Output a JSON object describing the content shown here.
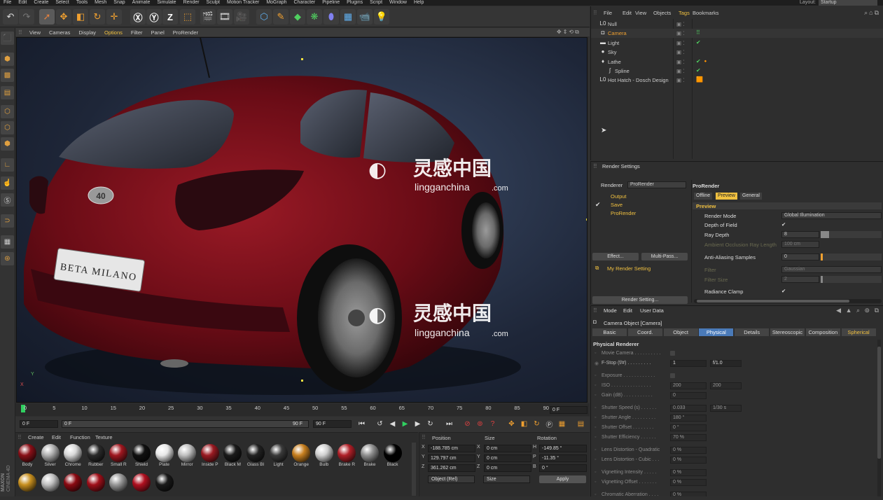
{
  "menubar": {
    "items": [
      "File",
      "Edit",
      "Create",
      "Select",
      "Tools",
      "Mesh",
      "Snap",
      "Animate",
      "Simulate",
      "Render",
      "Sculpt",
      "Motion Tracker",
      "MoGraph",
      "Character",
      "Pipeline",
      "Plugins",
      "Script",
      "Window",
      "Help"
    ],
    "layout_label": "Layout:",
    "layout_value": "Startup"
  },
  "viewport_menu": {
    "items": [
      "View",
      "Cameras",
      "Display",
      "Options",
      "Filter",
      "Panel",
      "ProRender"
    ],
    "active": "Options"
  },
  "viewport": {
    "plate_text": "BETA MILANO",
    "badge_text": "40",
    "watermark_cn": "灵感中国",
    "watermark_en": "lingganchina",
    "watermark_suffix": ".com",
    "axis_y": "Y",
    "axis_x": "X"
  },
  "timeline": {
    "ticks": [
      "0",
      "5",
      "10",
      "15",
      "20",
      "25",
      "30",
      "35",
      "40",
      "45",
      "50",
      "55",
      "60",
      "65",
      "70",
      "75",
      "80",
      "85",
      "90"
    ],
    "current_frame": "0 F"
  },
  "transport": {
    "start": "0 F",
    "preview_start": "0 F",
    "preview_end": "90 F",
    "end": "90 F"
  },
  "materials": {
    "menu": [
      "Create",
      "Edit",
      "Function",
      "Texture"
    ],
    "row1": [
      {
        "label": "Body",
        "color": "#8a1018"
      },
      {
        "label": "Silver",
        "color": "#b0b0b0"
      },
      {
        "label": "Chrome",
        "color": "#d8d8d8"
      },
      {
        "label": "Rubber",
        "color": "#2a2a2a"
      },
      {
        "label": "Small R",
        "color": "#a01820"
      },
      {
        "label": "Shield",
        "color": "#101010"
      },
      {
        "label": "Plate",
        "color": "#e8e8e8"
      },
      {
        "label": "Mirror",
        "color": "#c0c0c0"
      },
      {
        "label": "Inside P",
        "color": "#9a1a22"
      },
      {
        "label": "Black M",
        "color": "#1a1a1a"
      },
      {
        "label": "Glass Bl",
        "color": "#222222"
      },
      {
        "label": "Light",
        "color": "#3a3a3a"
      },
      {
        "label": "Orange",
        "color": "#c88020"
      },
      {
        "label": "Bulb",
        "color": "#d0d0d0"
      },
      {
        "label": "Brake R",
        "color": "#b02028"
      },
      {
        "label": "Brake",
        "color": "#909090"
      },
      {
        "label": "Black",
        "color": "#000000"
      }
    ],
    "row2": [
      {
        "color": "#c89020"
      },
      {
        "color": "#c0c0c0"
      },
      {
        "color": "#8a0a12"
      },
      {
        "color": "#a0101a"
      },
      {
        "color": "#999999"
      },
      {
        "color": "#b01020"
      },
      {
        "color": "#1a1a1a"
      }
    ]
  },
  "coords": {
    "headers": [
      "Position",
      "Size",
      "Rotation"
    ],
    "rows": [
      {
        "axis": "X",
        "pos": "-188.785 cm",
        "size_axis": "X",
        "size": "0 cm",
        "rot_axis": "H",
        "rot": "-149.85 °"
      },
      {
        "axis": "Y",
        "pos": "129.797 cm",
        "size_axis": "Y",
        "size": "0 cm",
        "rot_axis": "P",
        "rot": "-11.35 °"
      },
      {
        "axis": "Z",
        "pos": "361.262 cm",
        "size_axis": "Z",
        "size": "0 cm",
        "rot_axis": "B",
        "rot": "0 °"
      }
    ],
    "mode": "Object (Rel)",
    "size_mode": "Size",
    "apply": "Apply"
  },
  "object_manager": {
    "menu": [
      "File",
      "Edit",
      "View",
      "Objects",
      "Tags",
      "Bookmarks"
    ],
    "active_menu": "Tags",
    "objects": [
      {
        "name": "Null",
        "icon": "L0",
        "selected": false
      },
      {
        "name": "Camera",
        "icon": "◘",
        "selected": true
      },
      {
        "name": "Light",
        "icon": "▬",
        "selected": false
      },
      {
        "name": "Sky",
        "icon": "●",
        "selected": false
      },
      {
        "name": "Lathe",
        "icon": "♦",
        "selected": false
      },
      {
        "name": "Spline",
        "icon": "∫",
        "selected": false
      },
      {
        "name": "Hot Hatch - Dosch Design",
        "icon": "L0",
        "selected": false
      }
    ]
  },
  "render_settings": {
    "title": "Render Settings",
    "renderer_label": "Renderer",
    "renderer_value": "ProRender",
    "tree": [
      "Output",
      "Save",
      "ProRender"
    ],
    "effect_btn": "Effect...",
    "multipass_btn": "Multi-Pass...",
    "setting_name": "My Render Setting",
    "render_setting_btn": "Render Setting...",
    "panel_title": "ProRender",
    "tabs": [
      "Offline",
      "Preview",
      "General"
    ],
    "active_tab": "Preview",
    "section": "Preview",
    "fields": [
      {
        "label": "Render Mode",
        "value": "Global Illumination"
      },
      {
        "label": "Depth of Field",
        "value": "✔"
      },
      {
        "label": "Ray Depth",
        "value": "8"
      },
      {
        "label": "Ambient Occlusion Ray Length",
        "value": "100 cm"
      },
      {
        "label": "Anti-Aliasing Samples",
        "value": "0"
      },
      {
        "label": "Filter",
        "value": "Gaussian"
      },
      {
        "label": "Filter Size",
        "value": "2"
      },
      {
        "label": "Radiance Clamp",
        "value": "✔"
      }
    ]
  },
  "attributes": {
    "menu": [
      "Mode",
      "Edit",
      "User Data"
    ],
    "title": "Camera Object [Camera]",
    "tabs": [
      "Basic",
      "Coord.",
      "Object",
      "Physical",
      "Details",
      "Stereoscopic",
      "Composition",
      "Spherical"
    ],
    "active_tab": "Physical",
    "section": "Physical Renderer",
    "fields": [
      {
        "label": "Movie Camera . . . . . . . . . .",
        "value": ""
      },
      {
        "label": "F-Stop (f/#) . . . . . . . . .",
        "value": "1",
        "extra": "f/1.0"
      },
      {
        "label": "Exposure . . . . . . . . . . . .",
        "value": ""
      },
      {
        "label": "ISO . . . . . . . . . . . . . . .",
        "value": "200",
        "extra": "200"
      },
      {
        "label": "Gain (dB) . . . . . . . . . . .",
        "value": "0"
      },
      {
        "label": "Shutter Speed (s) . . . . . .",
        "value": "0.033",
        "extra": "1/30 s"
      },
      {
        "label": "Shutter Angle . . . . . . . . .",
        "value": "180 °"
      },
      {
        "label": "Shutter Offset . . . . . . . .",
        "value": "0 °"
      },
      {
        "label": "Shutter Efficiency . . . . . .",
        "value": "70 %"
      },
      {
        "label": "Lens Distortion - Quadratic",
        "value": "0 %"
      },
      {
        "label": "Lens Distortion - Cubic . . .",
        "value": "0 %"
      },
      {
        "label": "Vignetting Intensity . . . . .",
        "value": "0 %"
      },
      {
        "label": "Vignetting Offset . . . . . . .",
        "value": "0 %"
      },
      {
        "label": "Chromatic Aberration . . . .",
        "value": "0 %"
      }
    ]
  },
  "brand": {
    "line1": "MAXON",
    "line2": "CINEMA 4D"
  }
}
